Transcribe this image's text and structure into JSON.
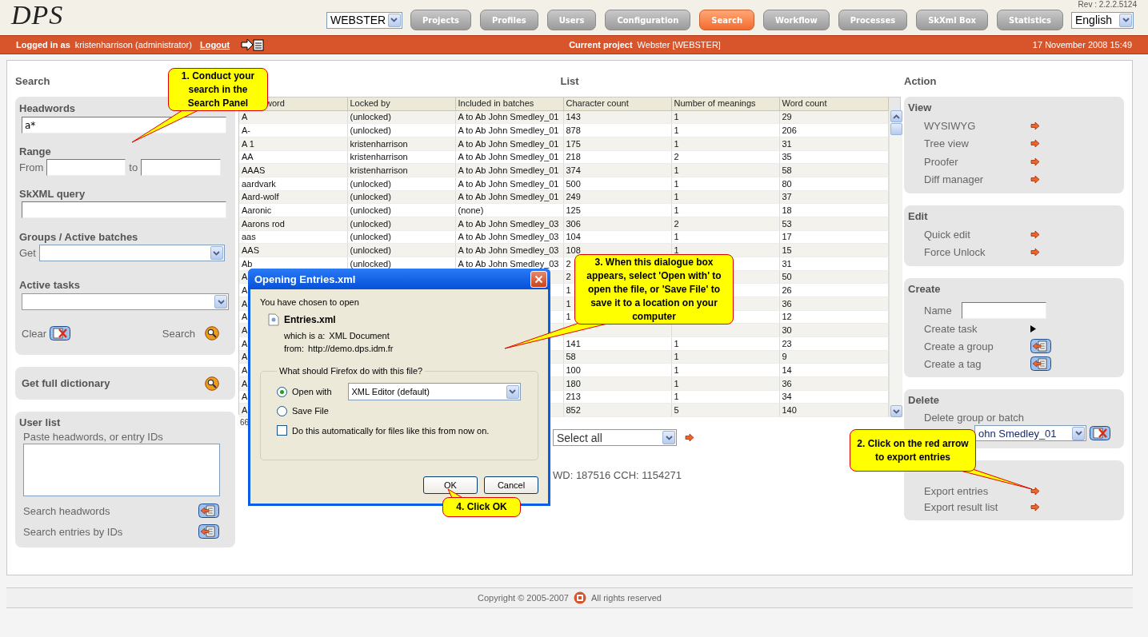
{
  "header": {
    "logo": "DPS",
    "revision": "Rev : 2.2.2.5124",
    "project_select": "WEBSTER",
    "language": "English",
    "nav": [
      {
        "label": "Projects",
        "selected": false
      },
      {
        "label": "Profiles",
        "selected": false
      },
      {
        "label": "Users",
        "selected": false
      },
      {
        "label": "Configuration",
        "selected": false
      },
      {
        "label": "Search",
        "selected": true
      },
      {
        "label": "Workflow",
        "selected": false
      },
      {
        "label": "Processes",
        "selected": false
      },
      {
        "label": "SkXml Box",
        "selected": false
      },
      {
        "label": "Statistics",
        "selected": false
      }
    ]
  },
  "user_bar": {
    "logged_in_label": "Logged in as",
    "user": "kristenharrison (administrator)",
    "logout": "Logout",
    "project_label": "Current project",
    "project": "Webster [WEBSTER]",
    "datetime": "17 November 2008 15:49"
  },
  "search_panel": {
    "title": "Search",
    "headwords_label": "Headwords",
    "headwords_value": "a*",
    "range_label": "Range",
    "from_label": "From",
    "to_label": "to",
    "skxml_label": "SkXML query",
    "groups_label": "Groups / Active batches",
    "get_label": "Get",
    "tasks_label": "Active tasks",
    "clear": "Clear",
    "search": "Search",
    "full_dictionary": "Get full dictionary",
    "user_list": {
      "title": "User list",
      "hint": "Paste headwords, or entry IDs",
      "search_headwords": "Search headwords",
      "search_ids": "Search entries by IDs"
    }
  },
  "list": {
    "title": "List",
    "columns": [
      "word",
      "Locked by",
      "Included in batches",
      "Character count",
      "Number of meanings",
      "Word count"
    ],
    "rows": [
      [
        "A",
        "(unlocked)",
        "A to Ab John Smedley_01",
        "143",
        "1",
        "29"
      ],
      [
        "A-",
        "(unlocked)",
        "A to Ab John Smedley_01",
        "878",
        "1",
        "206"
      ],
      [
        "A 1",
        "kristenharrison",
        "A to Ab John Smedley_01",
        "175",
        "1",
        "31"
      ],
      [
        "AA",
        "kristenharrison",
        "A to Ab John Smedley_01",
        "218",
        "2",
        "35"
      ],
      [
        "AAAS",
        "kristenharrison",
        "A to Ab John Smedley_01",
        "374",
        "1",
        "58"
      ],
      [
        "aardvark",
        "(unlocked)",
        "A to Ab John Smedley_01",
        "500",
        "1",
        "80"
      ],
      [
        "Aard-wolf",
        "(unlocked)",
        "A to Ab John Smedley_01",
        "249",
        "1",
        "37"
      ],
      [
        "Aaronic",
        "(unlocked)",
        "(none)",
        "125",
        "1",
        "18"
      ],
      [
        "Aarons rod",
        "(unlocked)",
        "A to Ab John Smedley_03",
        "306",
        "2",
        "53"
      ],
      [
        "aas",
        "(unlocked)",
        "A to Ab John Smedley_03",
        "104",
        "1",
        "17"
      ],
      [
        "AAS",
        "(unlocked)",
        "A to Ab John Smedley_03",
        "108",
        "1",
        "15"
      ],
      [
        "Ab",
        "(unlocked)",
        "A to Ab John Smedley_03",
        "2",
        null,
        "31"
      ],
      [
        "A",
        null,
        null,
        "2",
        null,
        "50"
      ],
      [
        "A",
        null,
        null,
        "1",
        null,
        "26"
      ],
      [
        "A",
        null,
        null,
        "1",
        null,
        "36"
      ],
      [
        "A",
        null,
        null,
        "1",
        null,
        "12"
      ],
      [
        "A",
        null,
        null,
        null,
        null,
        "30"
      ],
      [
        "A",
        null,
        null,
        "141",
        "1",
        "23"
      ],
      [
        "A",
        null,
        null,
        "58",
        "1",
        "9"
      ],
      [
        "A",
        null,
        null,
        "100",
        "1",
        "14"
      ],
      [
        "A",
        null,
        null,
        "180",
        "1",
        "36"
      ],
      [
        "A",
        null,
        null,
        "213",
        "1",
        "34"
      ],
      [
        "A",
        null,
        null,
        "852",
        "5",
        "140"
      ]
    ],
    "footer": "66",
    "select": "Select all",
    "stats": "WD: 187516 CCH: 1154271"
  },
  "action": {
    "title": "Action",
    "groups": [
      {
        "title": "View",
        "items": [
          {
            "label": "WYSIWYG",
            "kind": "arrow"
          },
          {
            "label": "Tree view",
            "kind": "arrow"
          },
          {
            "label": "Proofer",
            "kind": "arrow"
          },
          {
            "label": "Diff manager",
            "kind": "arrow"
          }
        ]
      },
      {
        "title": "Edit",
        "items": [
          {
            "label": "Quick edit",
            "kind": "arrow"
          },
          {
            "label": "Force Unlock",
            "kind": "arrow"
          }
        ]
      },
      {
        "title": "Create",
        "items": [
          {
            "label": "Name",
            "kind": "field"
          },
          {
            "label": "Create task",
            "kind": "play"
          },
          {
            "label": "Create a group",
            "kind": "button"
          },
          {
            "label": "Create a tag",
            "kind": "button"
          }
        ]
      },
      {
        "title": "Delete",
        "items": [
          {
            "label": "Delete group or batch",
            "kind": "text"
          },
          {
            "label": "ohn Smedley_01",
            "kind": "select"
          }
        ]
      },
      {
        "items": [
          {
            "label": "Export entries",
            "kind": "arrow"
          },
          {
            "label": "Export result list",
            "kind": "arrow"
          }
        ]
      }
    ]
  },
  "dialog": {
    "title": "Opening Entries.xml",
    "intro": "You have chosen to open",
    "file": "Entries.xml",
    "type_label": "which is a:",
    "type": "XML Document",
    "from_label": "from:",
    "from": "http://demo.dps.idm.fr",
    "question": "What should Firefox do with this file?",
    "options": [
      {
        "label": "Open with",
        "selected": true
      },
      {
        "label": "Save File",
        "selected": false
      }
    ],
    "app": "XML Editor (default)",
    "auto": {
      "label": "Do this automatically for files like this from now on.",
      "checked": false
    },
    "ok": "OK",
    "cancel": "Cancel"
  },
  "callouts": [
    "1. Conduct your search in the Search Panel",
    "3. When this dialogue box appears, select 'Open with' to open the file, or 'Save File' to save it to a location on your computer",
    "2. Click on the red arrow to export entries",
    "4. Click OK"
  ],
  "footer": {
    "copyright": "Copyright © 2005-2007",
    "rights": "All rights reserved"
  }
}
